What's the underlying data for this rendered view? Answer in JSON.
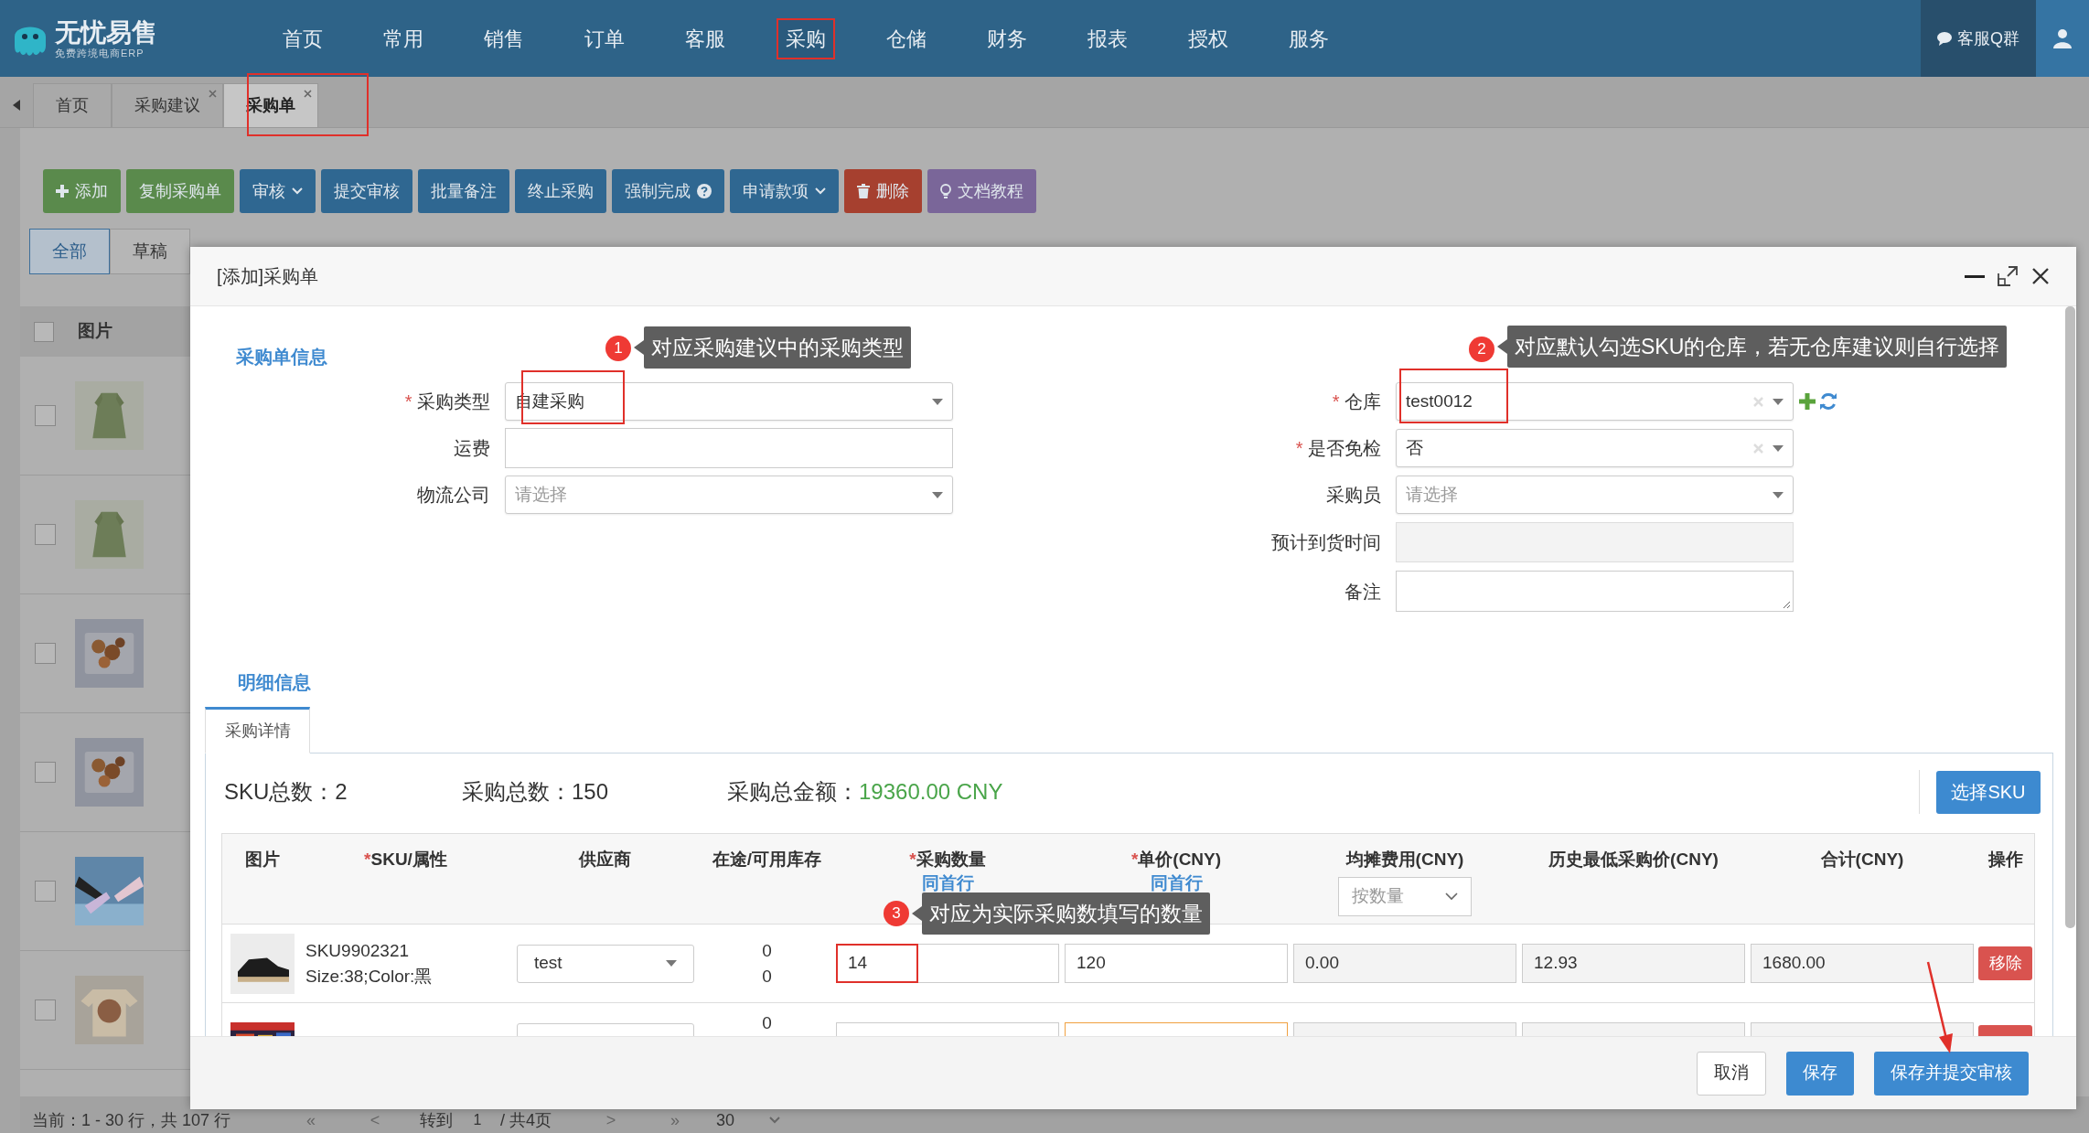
{
  "nav": {
    "logo": "无忧易售",
    "logo_subtitle": "免费跨境电商ERP",
    "items": [
      {
        "label": "首页",
        "selected": false
      },
      {
        "label": "常用",
        "selected": false
      },
      {
        "label": "销售",
        "selected": false
      },
      {
        "label": "订单",
        "selected": false
      },
      {
        "label": "客服",
        "selected": false
      },
      {
        "label": "采购",
        "selected": true
      },
      {
        "label": "仓储",
        "selected": false
      },
      {
        "label": "财务",
        "selected": false
      },
      {
        "label": "报表",
        "selected": false
      },
      {
        "label": "授权",
        "selected": false
      },
      {
        "label": "服务",
        "selected": false
      }
    ],
    "support": "客服Q群"
  },
  "page_tabs": [
    {
      "label": "首页",
      "closable": false,
      "selected": false
    },
    {
      "label": "采购建议",
      "closable": true,
      "selected": false
    },
    {
      "label": "采购单",
      "closable": true,
      "selected": true
    }
  ],
  "toolbar": [
    {
      "label": "添加",
      "kind": "success"
    },
    {
      "label": "复制采购单",
      "kind": "success"
    },
    {
      "label": "审核",
      "kind": "primary"
    },
    {
      "label": "提交审核",
      "kind": "primary"
    },
    {
      "label": "批量备注",
      "kind": "primary"
    },
    {
      "label": "终止采购",
      "kind": "primary"
    },
    {
      "label": "强制完成",
      "kind": "primary"
    },
    {
      "label": "申请款项",
      "kind": "primary"
    },
    {
      "label": "删除",
      "kind": "danger"
    },
    {
      "label": "文档教程",
      "kind": "info"
    }
  ],
  "filters": [
    {
      "label": "全部",
      "selected": true
    },
    {
      "label": "草稿",
      "selected": false
    }
  ],
  "list": {
    "all_checked": false,
    "header": "图片",
    "rows": [
      {
        "checked": false
      },
      {
        "checked": false
      },
      {
        "checked": false
      },
      {
        "checked": false
      },
      {
        "checked": false
      },
      {
        "checked": false
      }
    ]
  },
  "pagination": {
    "summary": "当前：1 - 30 行，共 107 行",
    "first": "«",
    "prev": "<",
    "goto": "转到",
    "page": "1",
    "total": "/ 共4页",
    "next": ">",
    "last": "»",
    "page_size": "30"
  },
  "required_mark": "*",
  "dialog": {
    "title": "[添加]采购单",
    "section_info": "采购单信息",
    "left_fields": [
      {
        "label": "采购类型",
        "required": true,
        "kind": "select",
        "value": "自建采购"
      },
      {
        "label": "运费",
        "required": false,
        "kind": "text"
      },
      {
        "label": "物流公司",
        "required": false,
        "kind": "select",
        "placeholder": "请选择"
      }
    ],
    "right_fields": [
      {
        "label": "仓库",
        "required": true,
        "kind": "select",
        "value": "test0012",
        "clearable": true
      },
      {
        "label": "是否免检",
        "required": true,
        "kind": "select",
        "value": "否",
        "clearable": true
      },
      {
        "label": "采购员",
        "required": false,
        "kind": "select",
        "placeholder": "请选择"
      },
      {
        "label": "预计到货时间",
        "required": false,
        "kind": "readonly"
      },
      {
        "label": "备注",
        "required": false,
        "kind": "textarea"
      }
    ],
    "section_detail": "明细信息",
    "detail_tab": {
      "label": "采购详情",
      "selected": true
    },
    "summary": [
      {
        "label": "SKU总数：",
        "value": "2",
        "highlight": false
      },
      {
        "label": "采购总数：",
        "value": "150",
        "highlight": false
      },
      {
        "label": "采购总金额：",
        "value": "19360.00 CNY",
        "highlight": true
      }
    ],
    "select_sku": "选择SKU",
    "columns": [
      {
        "label": "图片",
        "required": false
      },
      {
        "label": "SKU/属性",
        "required": true
      },
      {
        "label": "供应商",
        "required": false
      },
      {
        "label": "在途/可用库存",
        "required": false
      },
      {
        "label": "采购数量",
        "required": true,
        "link": "同首行"
      },
      {
        "label": "单价(CNY)",
        "required": true,
        "link": "同首行"
      },
      {
        "label": "均摊费用(CNY)",
        "required": false,
        "select": "按数量"
      },
      {
        "label": "历史最低采购价(CNY)",
        "required": false
      },
      {
        "label": "合计(CNY)",
        "required": false
      },
      {
        "label": "操作",
        "required": false
      }
    ],
    "rows": [
      {
        "sku": "SKU9902321",
        "attrs": "Size:38;Color:黑",
        "supplier": "test",
        "stock_in_transit": "0",
        "stock_available": "0",
        "quantity": "14",
        "price": "120",
        "shared_cost": "0.00",
        "lowest_price": "12.93",
        "total": "1680.00",
        "action": "移除",
        "price_focused": false
      },
      {
        "stock_in_transit": "0",
        "price_focused": true
      }
    ],
    "footer": [
      {
        "label": "取消",
        "kind": "default"
      },
      {
        "label": "保存",
        "kind": "primary"
      },
      {
        "label": "保存并提交审核",
        "kind": "primary"
      }
    ]
  },
  "annotations": [
    {
      "number": "1",
      "text": "对应采购建议中的采购类型"
    },
    {
      "number": "2",
      "text": "对应默认勾选SKU的仓库，若无仓库建议则自行选择"
    },
    {
      "number": "3",
      "text": "对应为实际采购数填写的数量"
    }
  ]
}
